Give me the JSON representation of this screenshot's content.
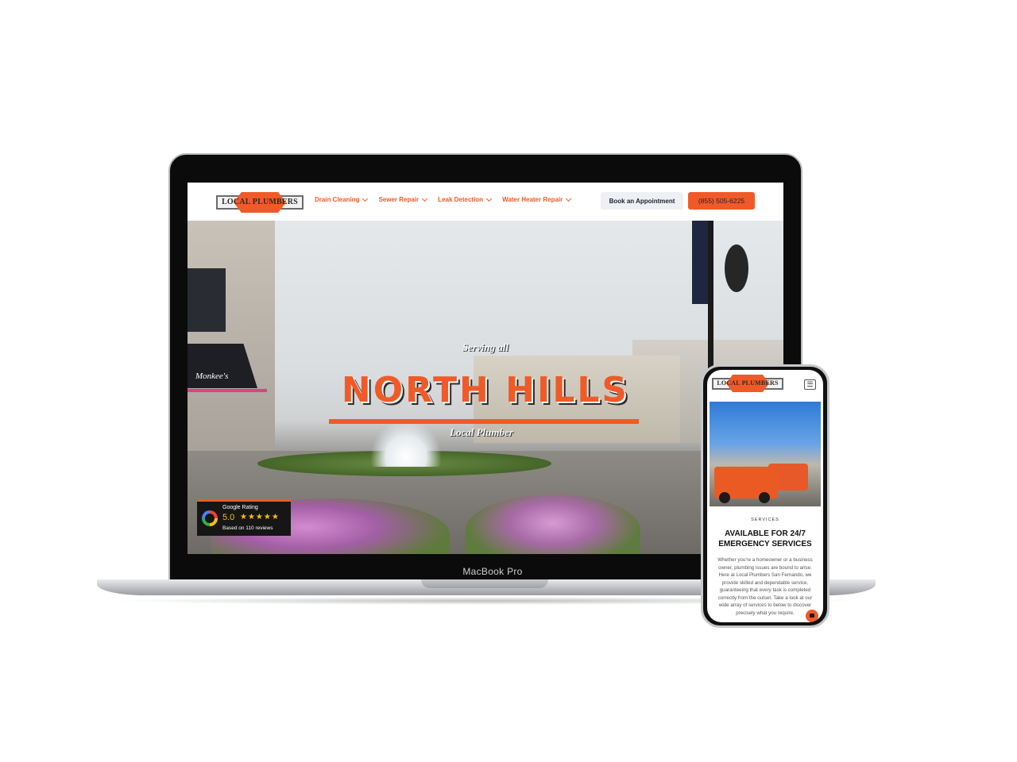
{
  "laptop": {
    "device_label": "MacBook Pro",
    "header": {
      "logo_text": "LOCAL PLUMBERS",
      "nav": [
        {
          "label": "Drain Cleaning"
        },
        {
          "label": "Sewer Repair"
        },
        {
          "label": "Leak Detection"
        },
        {
          "label": "Water Heater Repair"
        }
      ],
      "book_label": "Book an Appointment",
      "phone_label": "(855) 505-6225"
    },
    "hero": {
      "eyebrow": "Serving all",
      "title": "NORTH HILLS",
      "subtitle": "Local Plumber",
      "storefront_sign": "Monkee's"
    },
    "rating": {
      "title": "Google Rating",
      "score": "5.0",
      "stars": "★★★★★",
      "count": "Based on 110 reviews"
    }
  },
  "phone": {
    "logo_text": "LOCAL PLUMBERS",
    "menu_icon": "☰",
    "eyebrow": "SERVICES",
    "heading_line1": "AVAILABLE FOR 24/7",
    "heading_line2": "EMERGENCY SERVICES",
    "body": "Whether you're a homeowner or a business owner, plumbing issues are bound to arise. Here at Local Plumbers San Fernando, we provide skilled and dependable service, guaranteeing that every task is completed correctly from the outset. Take a look at our wide array of services to below to discover precisely what you require."
  },
  "colors": {
    "brand_orange": "#f05a28",
    "dark": "#1d2130"
  }
}
